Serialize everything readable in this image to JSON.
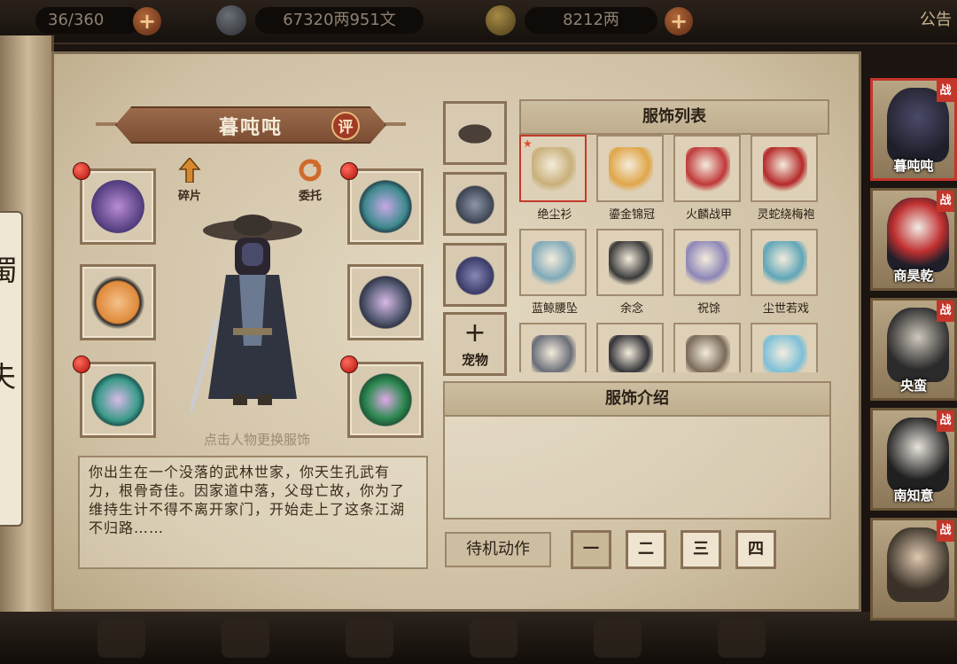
{
  "topbar": {
    "stamina": "36/360",
    "silver": "67320两951文",
    "gold": "8212两",
    "notice": "公告"
  },
  "left_scroll": {
    "chars": [
      "蜀",
      "夫"
    ]
  },
  "character": {
    "name": "暮吨吨",
    "rate_label": "评",
    "fragment_label": "碎片",
    "entrust_label": "委托",
    "hint": "点击人物更换服饰",
    "bio": "你出生在一个没落的武林世家，你天生孔武有力，根骨奇佳。因家道中落，父母亡故，你为了维持生计不得不离开家门，开始走上了这条江湖不归路……"
  },
  "equipment": {
    "left_slots": [
      "gauntlet-icon",
      "dagger-icon",
      "jade-ring-icon"
    ],
    "right_slots": [
      "hat-scarf-icon",
      "armor-icon",
      "jade-pendant-icon"
    ]
  },
  "costume_slots": {
    "items": [
      "straw-hat-icon",
      "scarf-icon",
      "mask-icon"
    ],
    "pet_label": "宠物"
  },
  "costume_list": {
    "title": "服饰列表",
    "items": [
      {
        "label": "绝尘衫",
        "icon": "robe-icon",
        "color": "#c9b07a"
      },
      {
        "label": "鎏金锦冠",
        "icon": "gold-crown-icon",
        "color": "#e0a648"
      },
      {
        "label": "火麟战甲",
        "icon": "fire-armor-icon",
        "color": "#c0393a"
      },
      {
        "label": "灵蛇绕梅袍",
        "icon": "red-robe-icon",
        "color": "#b52a2a"
      },
      {
        "label": "蓝鲸腰坠",
        "icon": "bead-pendant-icon",
        "color": "#7fa9b8"
      },
      {
        "label": "余念",
        "icon": "black-bracelet-icon",
        "color": "#3a3a3a"
      },
      {
        "label": "祝馀",
        "icon": "ribbon-charm-icon",
        "color": "#8d86b8"
      },
      {
        "label": "尘世若戏",
        "icon": "blue-bracelet-icon",
        "color": "#5fa6b8"
      },
      {
        "label": "",
        "icon": "silver-bracelet-icon",
        "color": "#6a6e78"
      },
      {
        "label": "",
        "icon": "dark-bracelet-icon",
        "color": "#333338"
      },
      {
        "label": "",
        "icon": "bead-bracelet-icon",
        "color": "#7a6a5a"
      },
      {
        "label": "",
        "icon": "ice-bracelet-icon",
        "color": "#7cc0d8"
      }
    ]
  },
  "costume_intro": {
    "title": "服饰介绍"
  },
  "idle": {
    "label": "待机动作",
    "buttons": [
      "一",
      "二",
      "三",
      "四"
    ]
  },
  "roster": {
    "war_badge": "战",
    "members": [
      "暮吨吨",
      "商昊乾",
      "央蛮",
      "南知意",
      ""
    ]
  }
}
